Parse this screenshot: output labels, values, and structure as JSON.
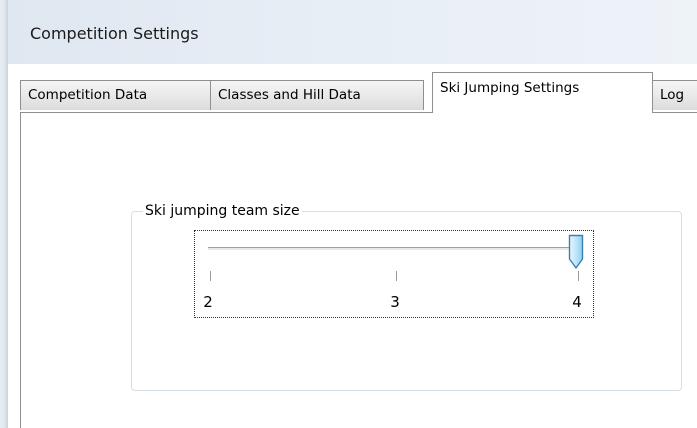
{
  "window": {
    "title": "Competition Settings"
  },
  "tabs": [
    {
      "label": "Competition Data",
      "active": false
    },
    {
      "label": "Classes and Hill Data",
      "active": false
    },
    {
      "label": "Ski Jumping Settings",
      "active": true
    },
    {
      "label": "Log",
      "active": false
    }
  ],
  "group": {
    "label": "Ski jumping team size"
  },
  "slider": {
    "min": 2,
    "max": 4,
    "value": 4,
    "ticks": [
      "2",
      "3",
      "4"
    ]
  },
  "colors": {
    "titlebar": "#e6edf5",
    "group_border": "#d5dfe5",
    "thumb_accent": "#3c9fd6"
  }
}
